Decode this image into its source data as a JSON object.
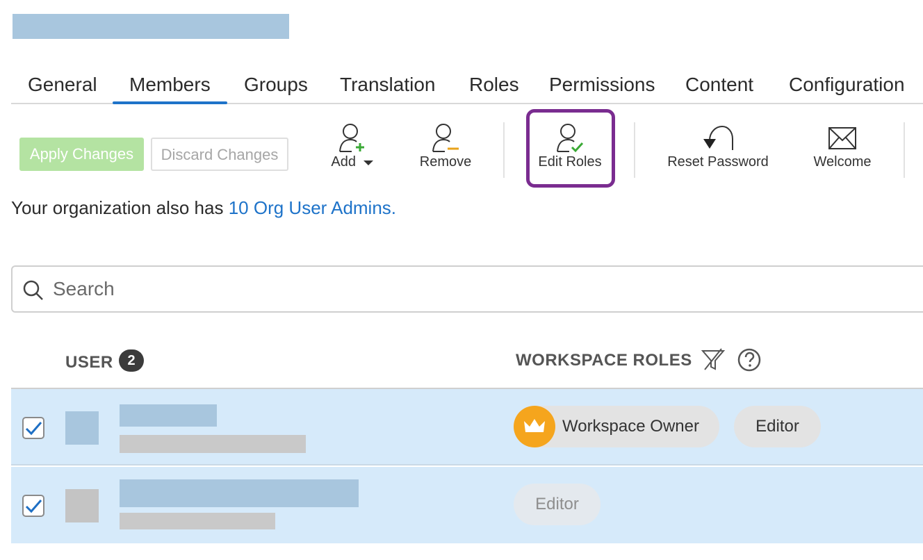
{
  "tabs": [
    {
      "label": "General"
    },
    {
      "label": "Members",
      "active": true
    },
    {
      "label": "Groups"
    },
    {
      "label": "Translation"
    },
    {
      "label": "Roles"
    },
    {
      "label": "Permissions"
    },
    {
      "label": "Content"
    },
    {
      "label": "Configuration"
    }
  ],
  "toolbar": {
    "apply_label": "Apply Changes",
    "discard_label": "Discard Changes",
    "add_label": "Add",
    "remove_label": "Remove",
    "edit_roles_label": "Edit Roles",
    "reset_password_label": "Reset Password",
    "welcome_label": "Welcome"
  },
  "org_notice": {
    "prefix": "Your organization also has ",
    "link": "10 Org User Admins."
  },
  "search": {
    "placeholder": "Search"
  },
  "table": {
    "user_header": "USER",
    "user_count": "2",
    "roles_header": "WORKSPACE ROLES",
    "rows": [
      {
        "checked": true,
        "roles": [
          "Workspace Owner",
          "Editor"
        ]
      },
      {
        "checked": true,
        "roles": [
          "Editor"
        ]
      }
    ]
  },
  "colors": {
    "accent": "#1e73c9",
    "highlight": "#7a2c90",
    "row_selected": "#d6eafa",
    "apply_green": "#b4e3a2",
    "owner_orange": "#f5a51d"
  }
}
